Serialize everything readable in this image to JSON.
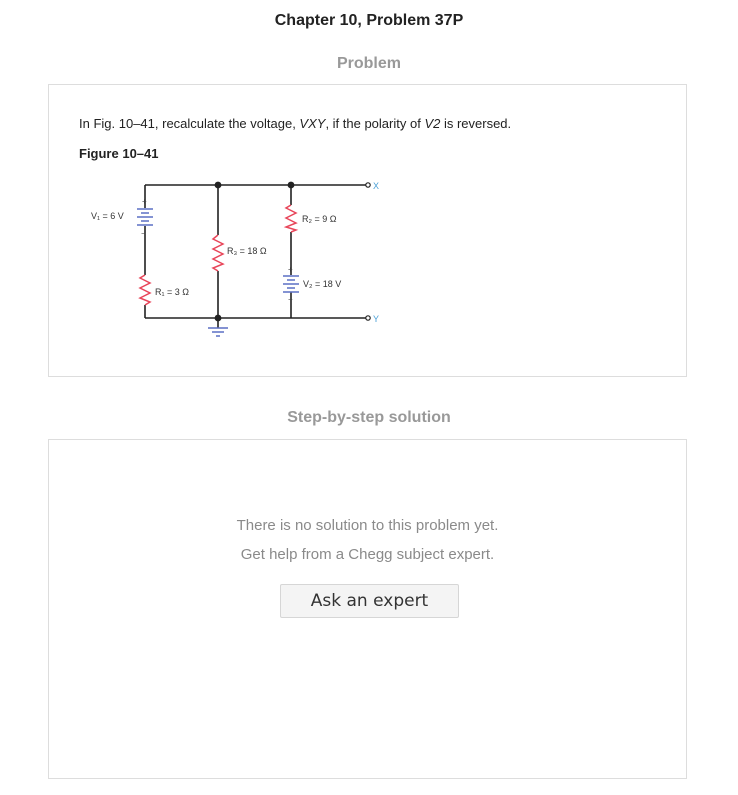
{
  "header": {
    "chapter_title": "Chapter 10, Problem 37P"
  },
  "problem_section": {
    "heading": "Problem",
    "text_prefix": "In Fig. 10–41, recalculate the voltage, ",
    "text_var1": "VXY",
    "text_middle": ", if the polarity of ",
    "text_var2": "V2",
    "text_suffix": " is reversed.",
    "figure_label": "Figure 10–41"
  },
  "circuit": {
    "v1_label": "V₁ = 6 V",
    "r1_label": "R₁ = 3 Ω",
    "r3_label": "R₃ = 18 Ω",
    "r2_label": "R₂ = 9 Ω",
    "v2_label": "V₂ = 18 V",
    "terminal_x": "X",
    "terminal_y": "Y",
    "plus_sign": "+",
    "minus_sign": "−",
    "colors": {
      "wire": "#222222",
      "resistor": "#e8465a",
      "battery": "#5b6fc4",
      "terminal_label": "#4a9fd6"
    }
  },
  "solution_section": {
    "heading": "Step-by-step solution",
    "no_solution_text": "There is no solution to this problem yet.",
    "get_help_text": "Get help from a Chegg subject expert.",
    "ask_button_label": "Ask an expert"
  }
}
